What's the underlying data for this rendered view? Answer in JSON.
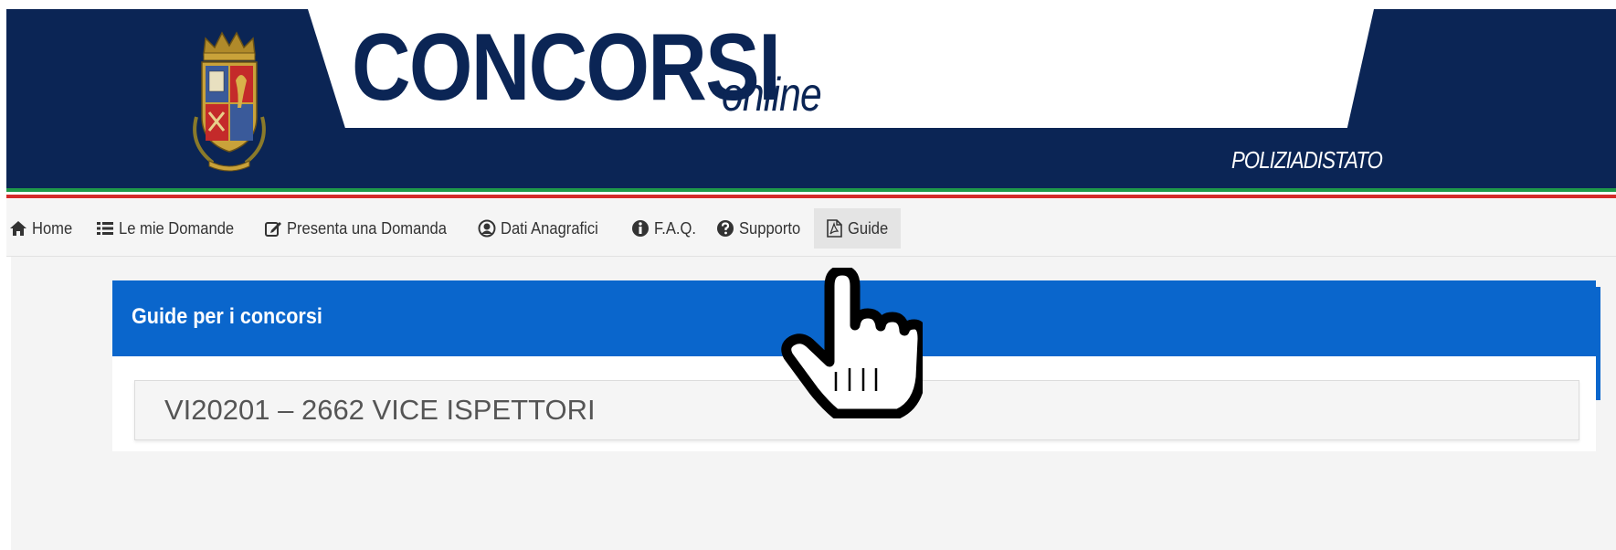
{
  "header": {
    "brand_main": "CONCORSI",
    "brand_sub": "online",
    "organization": "POLIZIADISTATO",
    "logo_icon": "polizia-di-stato-emblem"
  },
  "colors": {
    "header_bg": "#0b2555",
    "panel_heading": "#0a66cc",
    "flag_green": "#1e9a4a",
    "flag_red": "#d52b2b"
  },
  "nav": {
    "items": [
      {
        "label": "Home",
        "icon": "home-icon"
      },
      {
        "label": "Le mie Domande",
        "icon": "list-icon"
      },
      {
        "label": "Presenta una Domanda",
        "icon": "edit-icon"
      },
      {
        "label": "Dati Anagrafici",
        "icon": "user-circle-icon"
      },
      {
        "label": "F.A.Q.",
        "icon": "info-icon"
      },
      {
        "label": "Supporto",
        "icon": "question-icon"
      },
      {
        "label": "Guide",
        "icon": "pdf-file-icon",
        "active": true
      }
    ]
  },
  "panel": {
    "title": "Guide per i concorsi",
    "items": [
      {
        "label": "VI20201 – 2662 VICE ISPETTORI"
      }
    ]
  },
  "cursor": {
    "icon": "hand-pointer-icon"
  }
}
